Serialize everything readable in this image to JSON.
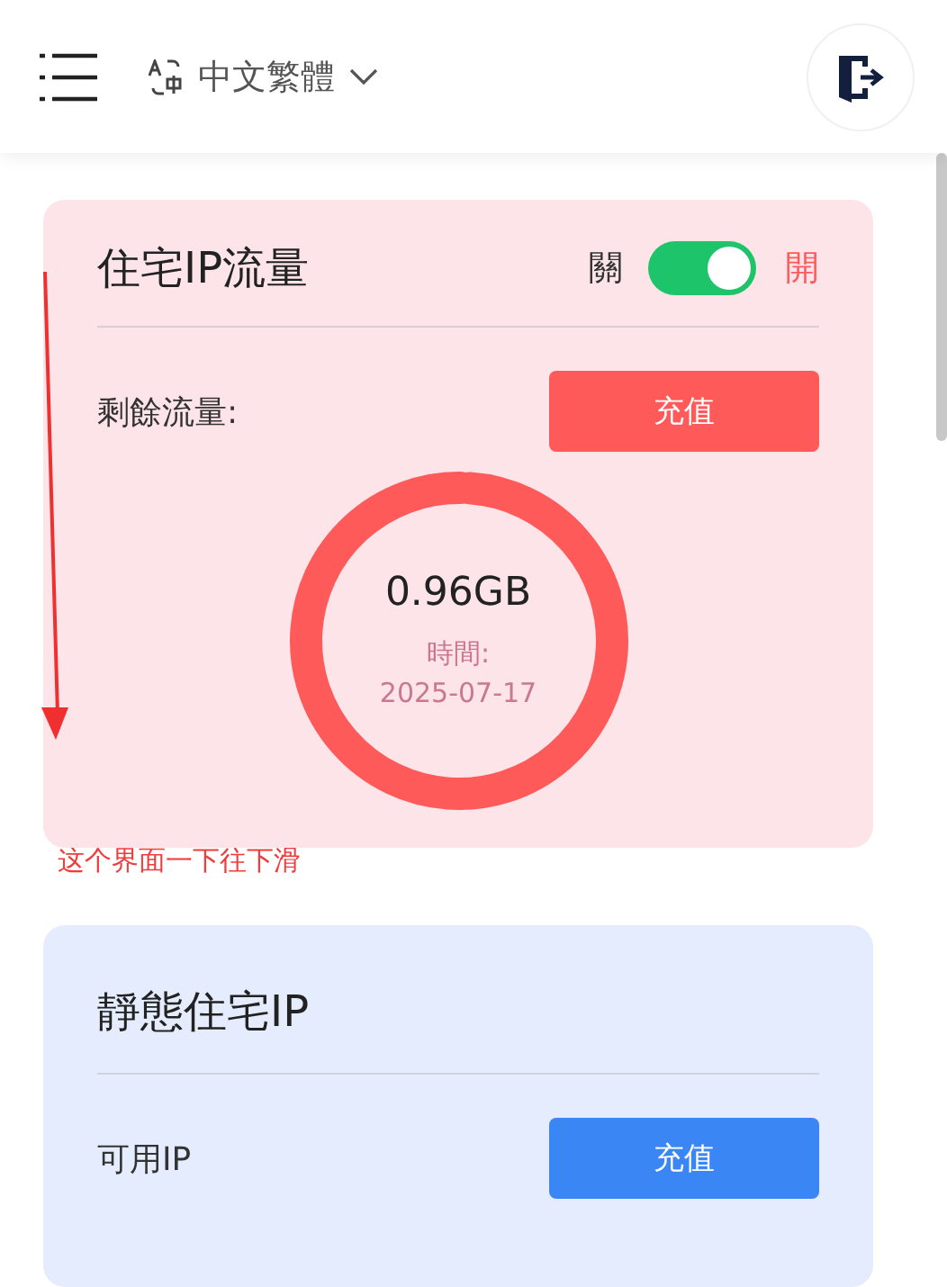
{
  "header": {
    "language": "中文繁體"
  },
  "traffic_card": {
    "title": "住宅IP流量",
    "toggle_off_label": "關",
    "toggle_on_label": "開",
    "on": true,
    "remaining_label": "剩餘流量:",
    "recharge_button": "充值",
    "amount": "0.96GB",
    "time_label": "時間:",
    "date": "2025-07-17"
  },
  "annotation": "这个界面一下往下滑",
  "static_card": {
    "title": "靜態住宅IP",
    "available_label": "可用IP",
    "recharge_button": "充值"
  }
}
